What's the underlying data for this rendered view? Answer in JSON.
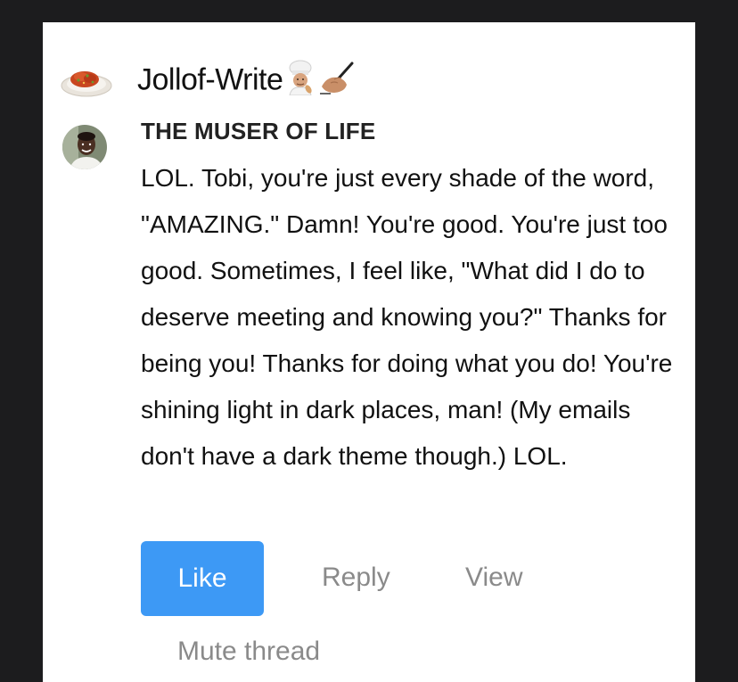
{
  "site": {
    "logo_icon": "jollof-rice-plate-icon",
    "name": "Jollof-Write",
    "emojis": [
      "chef-emoji",
      "writing-hand-emoji"
    ]
  },
  "comment": {
    "avatar_icon": "avatar-photo",
    "author": "THE MUSER OF LIFE",
    "text": "LOL. Tobi, you're just every shade of the word, \"AMAZING.\" Damn! You're good. You're just too good. Sometimes, I feel like, \"What did I do to deserve meeting and knowing you?\" Thanks for being you! Thanks for doing what you do! You're shining light in dark places, man! (My emails don't have a dark theme though.) LOL."
  },
  "actions": {
    "like_label": "Like",
    "reply_label": "Reply",
    "view_label": "View",
    "mute_label": "Mute thread"
  },
  "colors": {
    "accent": "#3d99f5",
    "muted_text": "#8a8a8a",
    "background": "#1c1c1e"
  }
}
